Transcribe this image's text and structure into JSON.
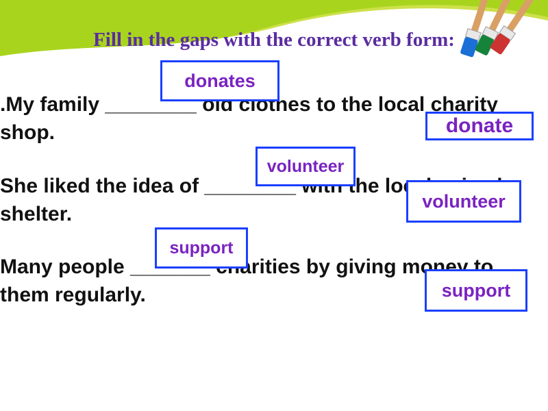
{
  "title": "Fill in the gaps with the correct verb form:",
  "sentences": {
    "s1": ".My family ________ old clothes to the local charity shop.",
    "s2": "She liked the idea of ________ with the local animal shelter.",
    "s3": "Many people _______ charities by giving  money to them regularly."
  },
  "answers": {
    "a1": "donates",
    "a2": "donate",
    "a3": "volunteer",
    "a4": "volunteer",
    "a5": "support",
    "a6": "support"
  }
}
